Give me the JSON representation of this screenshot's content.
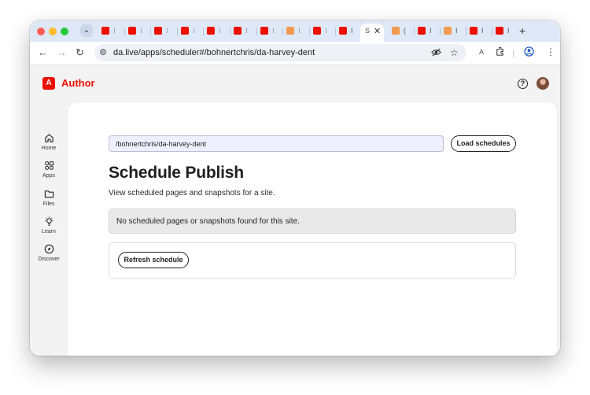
{
  "browser": {
    "traffic_lights": [
      "#ff5f57",
      "#febc2e",
      "#28c840"
    ],
    "tab_search_glyph": "⌄",
    "tabs": [
      {
        "icon": "adobe-favicon",
        "suffix": "⁝"
      },
      {
        "icon": "adobe-favicon",
        "suffix": "⁝"
      },
      {
        "icon": "adobe-favicon",
        "suffix": "⁝"
      },
      {
        "icon": "adobe-favicon",
        "suffix": "⁝"
      },
      {
        "icon": "adobe-favicon",
        "suffix": "⁝"
      },
      {
        "icon": "adobe-favicon",
        "suffix": "⁝"
      },
      {
        "icon": "adobe-favicon",
        "suffix": "⁝"
      },
      {
        "icon": "orange-favicon",
        "suffix": "⁝"
      },
      {
        "icon": "adobe-favicon",
        "suffix": "⁝"
      },
      {
        "icon": "adobe-favicon",
        "suffix": "I"
      },
      {
        "icon": "active",
        "suffix": "S"
      },
      {
        "icon": "orange-favicon",
        "suffix": "("
      },
      {
        "icon": "adobe-favicon",
        "suffix": "I"
      },
      {
        "icon": "orange-favicon",
        "suffix": "I"
      },
      {
        "icon": "adobe-favicon",
        "suffix": "I"
      },
      {
        "icon": "adobe-favicon",
        "suffix": "I"
      }
    ],
    "active_tab_label": "S",
    "close_glyph": "✕",
    "new_tab_glyph": "+",
    "url": "da.live/apps/scheduler#/bohnertchris/da-harvey-dent",
    "extension_badge": "A"
  },
  "app": {
    "brand_logo_letter": "A",
    "brand_name": "Author",
    "brand_color": "#eb1000",
    "help_glyph": "?"
  },
  "sidenav": {
    "items": [
      {
        "label": "Home",
        "icon": "home-icon"
      },
      {
        "label": "Apps",
        "icon": "apps-icon"
      },
      {
        "label": "Files",
        "icon": "folder-icon"
      },
      {
        "label": "Learn",
        "icon": "lightbulb-icon"
      },
      {
        "label": "Discover",
        "icon": "discover-icon"
      }
    ]
  },
  "scheduler": {
    "path_value": "/bohnertchris/da-harvey-dent",
    "load_button": "Load schedules",
    "title": "Schedule Publish",
    "description": "View scheduled pages and snapshots for a site.",
    "empty_message": "No scheduled pages or snapshots found for this site.",
    "refresh_button": "Refresh schedule"
  }
}
